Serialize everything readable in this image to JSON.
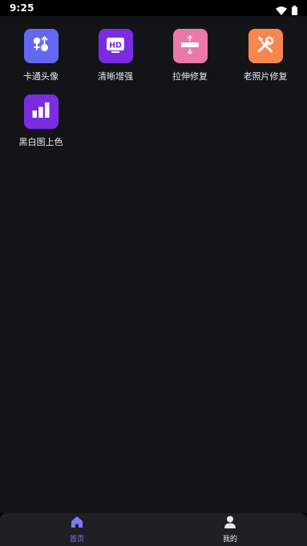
{
  "status_bar": {
    "time": "9:25",
    "icons": [
      "wifi-icon",
      "battery-icon"
    ]
  },
  "tools": [
    {
      "label": "卡通头像",
      "icon": "cartoon-avatar-icon",
      "color": "#6467f2"
    },
    {
      "label": "清晰增强",
      "icon": "hd-icon",
      "color": "#7b2be0"
    },
    {
      "label": "拉伸修复",
      "icon": "stretch-icon",
      "color": "#e97aa8"
    },
    {
      "label": "老照片修复",
      "icon": "tools-icon",
      "color": "#f7874f"
    },
    {
      "label": "黑白图上色",
      "icon": "bar-chart-icon",
      "color": "#7b2be0"
    }
  ],
  "bottom_nav": {
    "items": [
      {
        "label": "首页",
        "icon": "home-icon",
        "active": true
      },
      {
        "label": "我的",
        "icon": "user-icon",
        "active": false
      }
    ],
    "active_color": "#a16af0",
    "inactive_color": "#e8e8ea"
  }
}
